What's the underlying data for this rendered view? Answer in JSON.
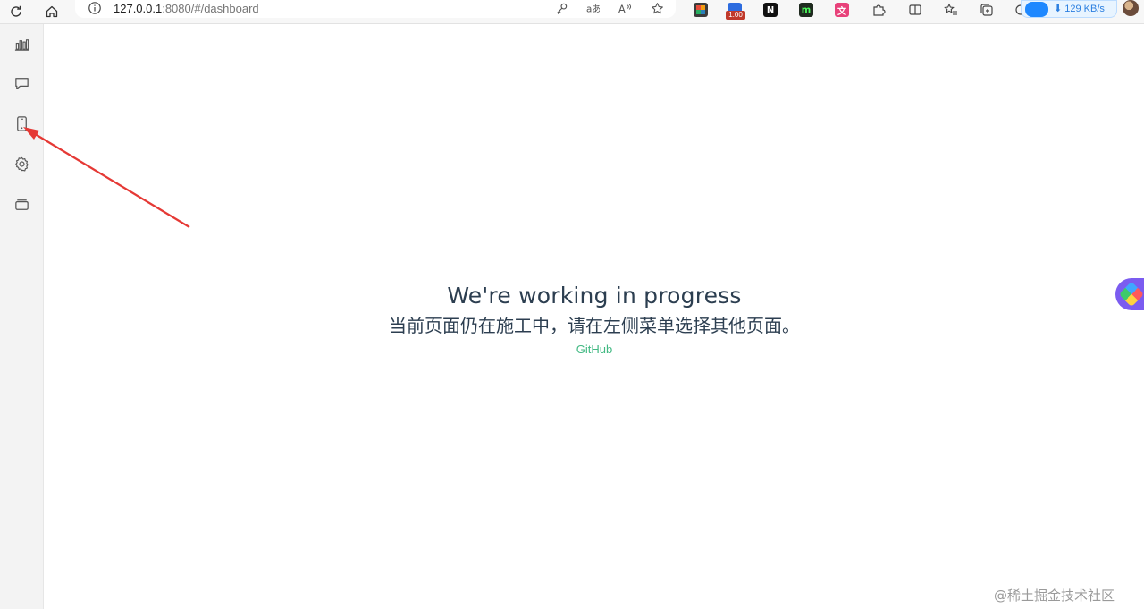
{
  "browser": {
    "url_host": "127.0.0.1",
    "url_rest": ":8080/#/dashboard",
    "extension_badge": "1.00",
    "download_speed": "⬇ 129 KB/s",
    "icons": {
      "reload": "reload-icon",
      "home": "home-icon",
      "info": "info-icon",
      "key": "key-icon",
      "translate": "translate-icon",
      "read_aloud": "read-aloud-icon",
      "favorite": "star-icon"
    }
  },
  "sidebar": {
    "items": [
      {
        "icon": "bar-chart-icon"
      },
      {
        "icon": "chat-icon"
      },
      {
        "icon": "mobile-device-icon"
      },
      {
        "icon": "gear-icon"
      },
      {
        "icon": "card-stack-icon"
      }
    ]
  },
  "main": {
    "heading": "We're working in progress",
    "subheading": "当前页面仍在施工中，请在左侧菜单选择其他页面。",
    "link_label": "GitHub"
  },
  "watermark": "@稀土掘金技术社区",
  "colors": {
    "accent_link": "#42b983",
    "text": "#2c3e50",
    "sidebar_bg": "#f3f3f3",
    "annotation_arrow": "#e53935"
  }
}
